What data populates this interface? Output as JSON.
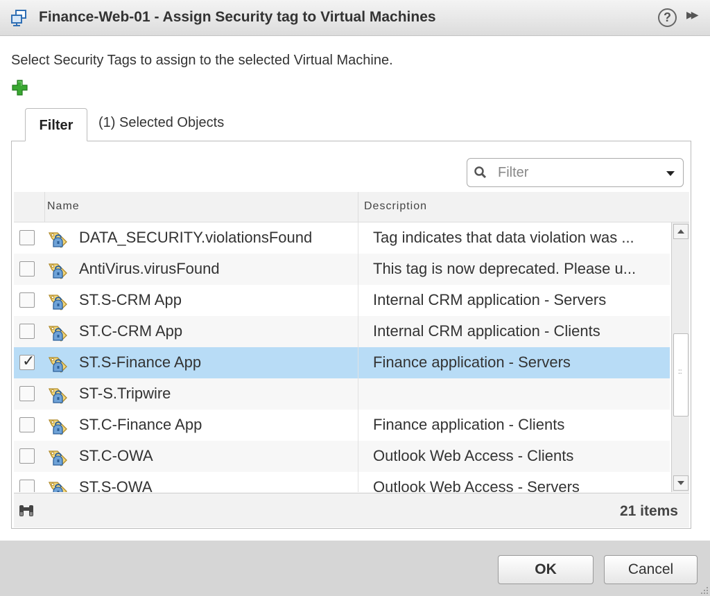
{
  "dialog": {
    "title": "Finance-Web-01 - Assign Security tag to Virtual Machines",
    "title_icon": "vm-group-icon",
    "help_label": "?",
    "expand_label": "▶▶"
  },
  "instruction": "Select Security Tags to assign to the selected Virtual Machine.",
  "add_icon": "green-plus-icon",
  "tabs": [
    {
      "label": "Filter",
      "active": true
    },
    {
      "label": "(1) Selected Objects",
      "active": false
    }
  ],
  "filter": {
    "placeholder": "Filter"
  },
  "grid": {
    "columns": [
      "Name",
      "Description"
    ],
    "rows": [
      {
        "name": "DATA_SECURITY.violationsFound",
        "description": "Tag indicates that data violation was ...",
        "checked": false
      },
      {
        "name": "AntiVirus.virusFound",
        "description": "This tag is now deprecated. Please u...",
        "checked": false
      },
      {
        "name": "ST.S-CRM App",
        "description": "Internal CRM application - Servers",
        "checked": false
      },
      {
        "name": "ST.C-CRM App",
        "description": "Internal CRM application - Clients",
        "checked": false
      },
      {
        "name": "ST.S-Finance App",
        "description": "Finance application - Servers",
        "checked": true
      },
      {
        "name": "ST-S.Tripwire",
        "description": "",
        "checked": false
      },
      {
        "name": "ST.C-Finance App",
        "description": "Finance application - Clients",
        "checked": false
      },
      {
        "name": "ST.C-OWA",
        "description": "Outlook Web Access - Clients",
        "checked": false
      },
      {
        "name": "ST.S-OWA",
        "description": "Outlook Web Access - Servers",
        "checked": false
      }
    ],
    "item_count": "21 items"
  },
  "buttons": {
    "ok": "OK",
    "cancel": "Cancel"
  },
  "colors": {
    "selected_row": "#b8dcf6",
    "footer_bg": "#d6d6d6",
    "add_green": "#3aa832"
  }
}
